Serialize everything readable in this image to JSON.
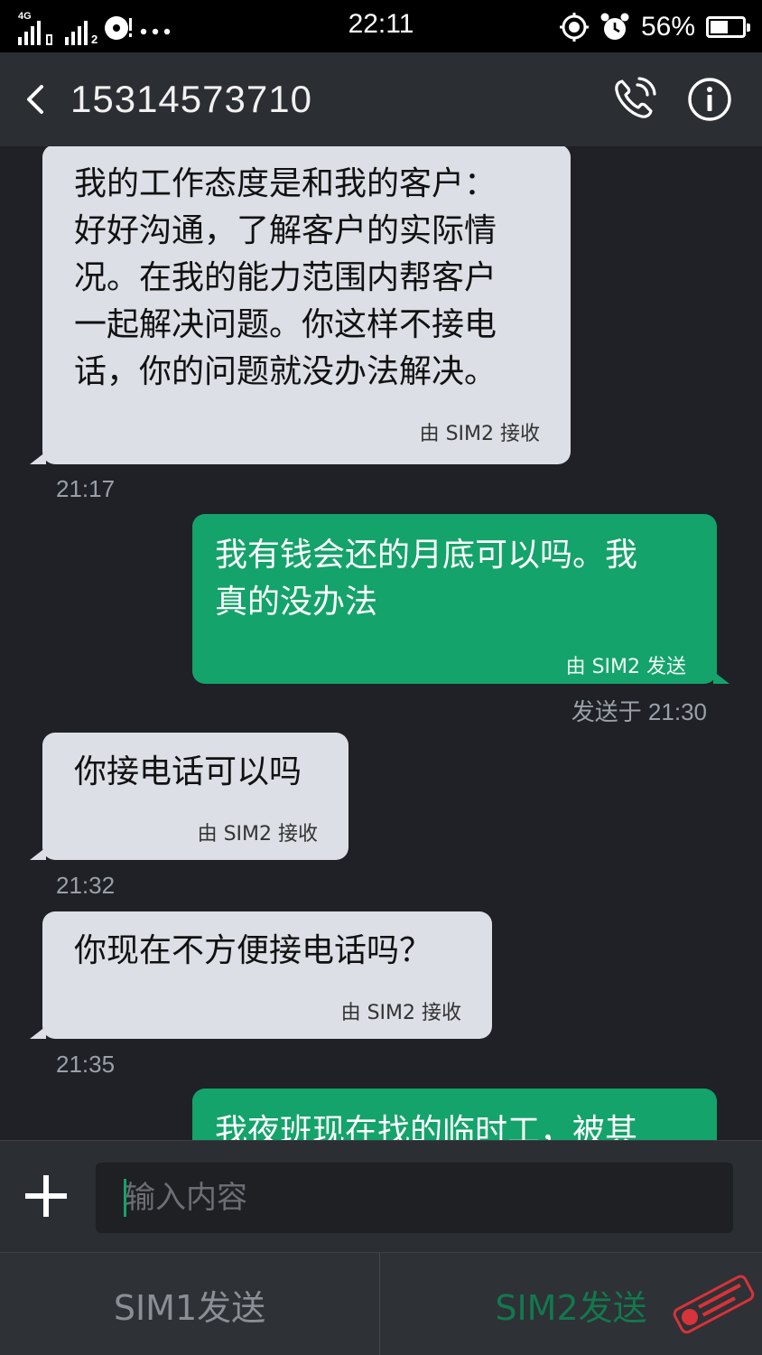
{
  "status_bar": {
    "network": "4G",
    "sim2_index": "2",
    "time": "22:11",
    "battery": "56%",
    "battery_level": 0.56,
    "icons": [
      "signal-icon",
      "notification-icon",
      "more-dots-icon",
      "location-icon",
      "alarm-icon",
      "battery-icon"
    ]
  },
  "header": {
    "title": "15314573710",
    "icons": [
      "back-arrow-icon",
      "phone-call-icon",
      "info-icon"
    ]
  },
  "messages": [
    {
      "direction": "in",
      "text": "我的工作态度是和我的客户：\n好好沟通，了解客户的实际情\n况。在我的能力范围内帮客户\n一起解决问题。你这样不接电\n话，你的问题就没办法解决。",
      "meta": "由 SIM2 接收",
      "time": "21:17"
    },
    {
      "direction": "out",
      "text": "我有钱会还的月底可以吗。我\n真的没办法",
      "meta": "由 SIM2 发送",
      "time": "发送于 21:30"
    },
    {
      "direction": "in",
      "text": "你接电话可以吗",
      "meta": "由 SIM2 接收",
      "time": "21:32"
    },
    {
      "direction": "in",
      "text": "你现在不方便接电话吗？",
      "meta": "由 SIM2 接收",
      "time": "21:35"
    },
    {
      "direction": "out",
      "text": "我夜班现在找的临时工，被其",
      "meta": "",
      "time": ""
    }
  ],
  "input": {
    "placeholder": "输入内容",
    "value": ""
  },
  "send_buttons": {
    "sim1_label": "SIM1发送",
    "sim2_label": "SIM2发送"
  },
  "colors": {
    "incoming_bubble": "#dcdfe6",
    "outgoing_bubble": "#14a36a",
    "background": "#1f2126",
    "header": "#2b2e33"
  }
}
